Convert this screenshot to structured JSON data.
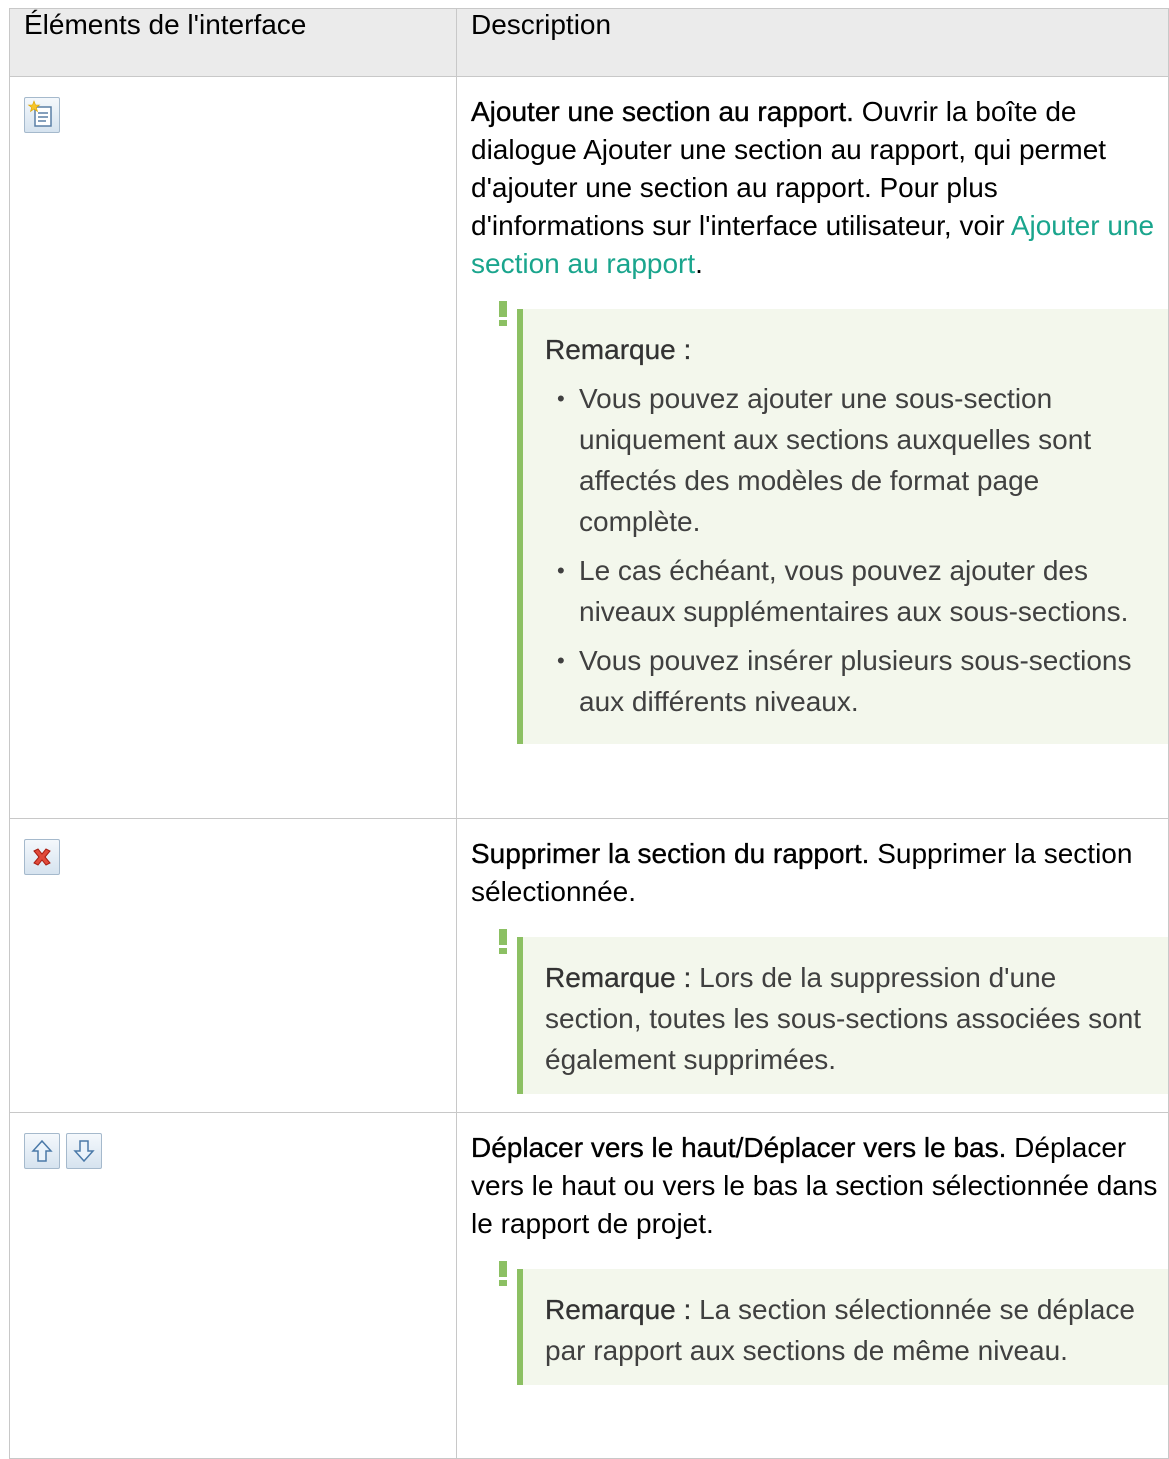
{
  "table": {
    "headers": [
      "Éléments de l'interface",
      "Description"
    ],
    "rows": [
      {
        "icons": [
          "add-section-icon"
        ],
        "title": "Ajouter une section au rapport.",
        "text_before_link": " Ouvrir la boîte de dialogue Ajouter une section au rapport, qui permet d'ajouter une section au rapport. Pour plus d'informations sur l'interface utilisateur, voir ",
        "link": "Ajouter une section au rapport",
        "text_after_link": ".",
        "note_label": "Remarque :",
        "note_items": [
          "Vous pouvez ajouter une sous-section uniquement aux sections auxquelles sont affectés des modèles de format page complète.",
          "Le cas échéant, vous pouvez ajouter des niveaux supplémentaires aux sous-sections.",
          "Vous pouvez insérer plusieurs sous-sections aux différents niveaux."
        ]
      },
      {
        "icons": [
          "delete-section-icon"
        ],
        "title": "Supprimer la section du rapport.",
        "text": " Supprimer la section sélectionnée.",
        "note_label": "Remarque :",
        "note_text": " Lors de la suppression d'une section, toutes les sous-sections associées sont également supprimées."
      },
      {
        "icons": [
          "move-up-icon",
          "move-down-icon"
        ],
        "title": "Déplacer vers le haut/Déplacer vers le bas.",
        "text": " Déplacer vers le haut ou vers le bas la section sélectionnée dans le rapport de projet.",
        "note_label": "Remarque :",
        "note_text": " La section sélectionnée se déplace par rapport aux sections de même niveau."
      }
    ]
  },
  "colors": {
    "link": "#1aa58d",
    "note_border": "#8cc063",
    "note_bg": "#f3f7ec",
    "header_bg": "#ebebeb"
  }
}
